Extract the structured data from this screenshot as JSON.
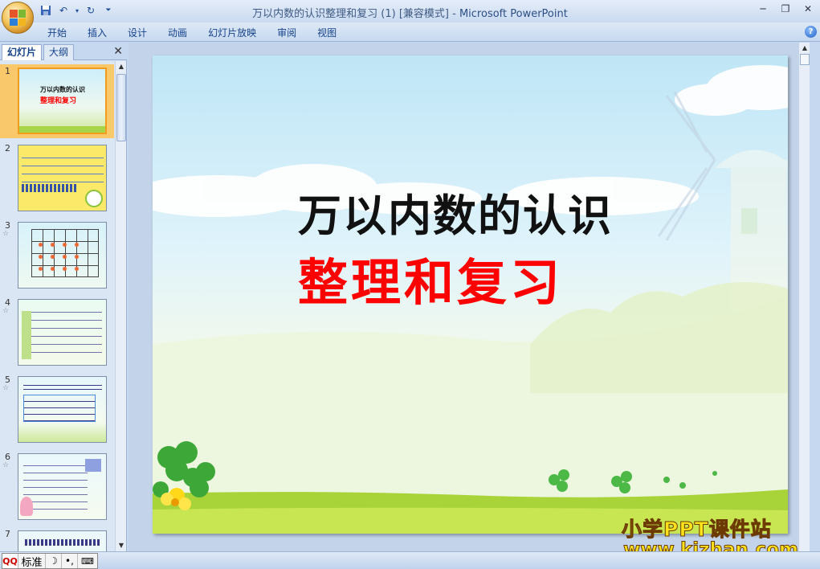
{
  "window": {
    "title": "万以内数的认识整理和复习 (1) [兼容模式]",
    "title_separator": " - ",
    "app_name": "Microsoft PowerPoint",
    "controls": [
      "minimize",
      "restore",
      "close"
    ]
  },
  "quick_access": [
    "save-icon",
    "undo-icon",
    "dropdown-icon",
    "redo-icon",
    "customize-icon"
  ],
  "ribbon": {
    "tabs": [
      "开始",
      "插入",
      "设计",
      "动画",
      "幻灯片放映",
      "审阅",
      "视图"
    ]
  },
  "slides_pane": {
    "tabs": [
      "幻灯片",
      "大纲"
    ],
    "active_tab": "幻灯片",
    "close_label": "✕",
    "thumbnails": [
      {
        "number": "1",
        "selected": true,
        "has_animation": false
      },
      {
        "number": "2",
        "selected": false,
        "has_animation": false
      },
      {
        "number": "3",
        "selected": false,
        "has_animation": true
      },
      {
        "number": "4",
        "selected": false,
        "has_animation": true
      },
      {
        "number": "5",
        "selected": false,
        "has_animation": true
      },
      {
        "number": "6",
        "selected": false,
        "has_animation": true
      },
      {
        "number": "7",
        "selected": false,
        "has_animation": false
      }
    ],
    "thumb1_title": "万以内数的认识",
    "thumb1_subtitle": "整理和复习"
  },
  "slide": {
    "title": "万以内数的认识",
    "subtitle": "整理和复习"
  },
  "watermark": {
    "line1": "小学PPT课件站",
    "line2": "www.kjzhan.com"
  },
  "ime_bar": {
    "mode": "标准",
    "logo": "QQ"
  },
  "colors": {
    "subtitle_red": "#ff0000",
    "title_black": "#111111",
    "selected_thumb": "#f9c86a",
    "watermark_yellow": "#ffe21a"
  }
}
